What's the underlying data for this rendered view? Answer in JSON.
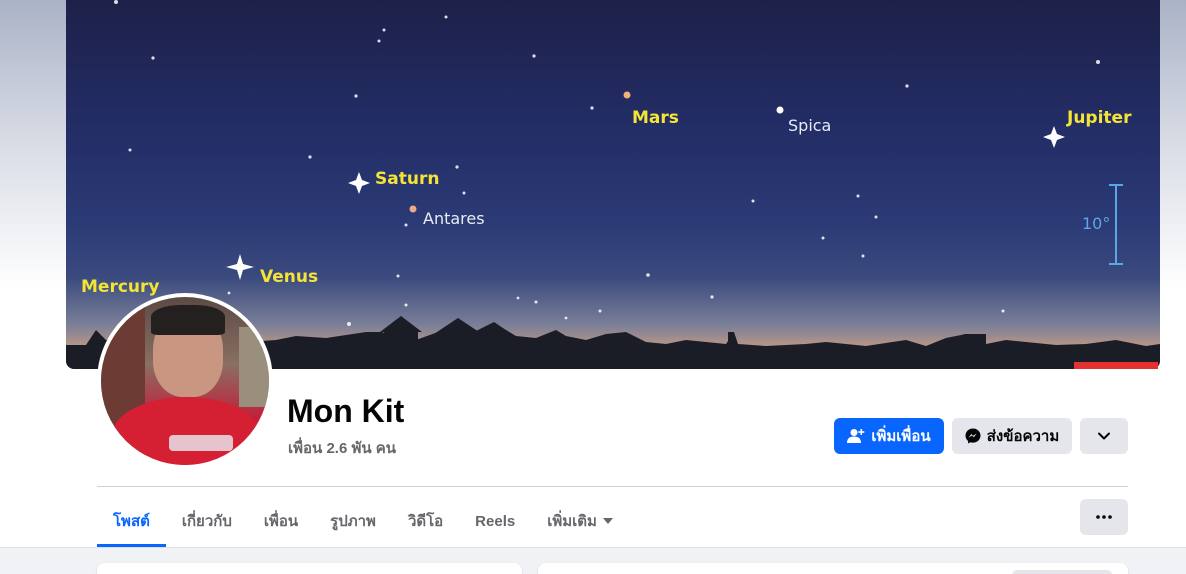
{
  "cover": {
    "labels": {
      "mercury": "Mercury",
      "venus": "Venus",
      "saturn": "Saturn",
      "antares": "Antares",
      "mars": "Mars",
      "spica": "Spica",
      "jupiter": "Jupiter",
      "scale": "10°"
    },
    "colors": {
      "planet_label": "#f3e437",
      "star_label": "#e8ecf5",
      "scale": "#5aa7e8"
    }
  },
  "profile": {
    "name": "Mon Kit",
    "friends": "เพื่อน 2.6 พัน คน"
  },
  "actions": {
    "add_friend": {
      "label": "เพิ่มเพื่อน",
      "icon": "person-add-icon",
      "color": "#0866ff"
    },
    "message": {
      "label": "ส่งข้อความ",
      "icon": "messenger-icon"
    },
    "more": {
      "icon": "chevron-down-icon"
    },
    "menu": {
      "icon": "more-dots-icon"
    }
  },
  "tabs": [
    {
      "label": "โพสต์",
      "active": true
    },
    {
      "label": "เกี่ยวกับ"
    },
    {
      "label": "เพื่อน"
    },
    {
      "label": "รูปภาพ"
    },
    {
      "label": "วิดีโอ"
    },
    {
      "label": "Reels"
    },
    {
      "label": "เพิ่มเติม",
      "icon": "caret-down-icon"
    }
  ]
}
